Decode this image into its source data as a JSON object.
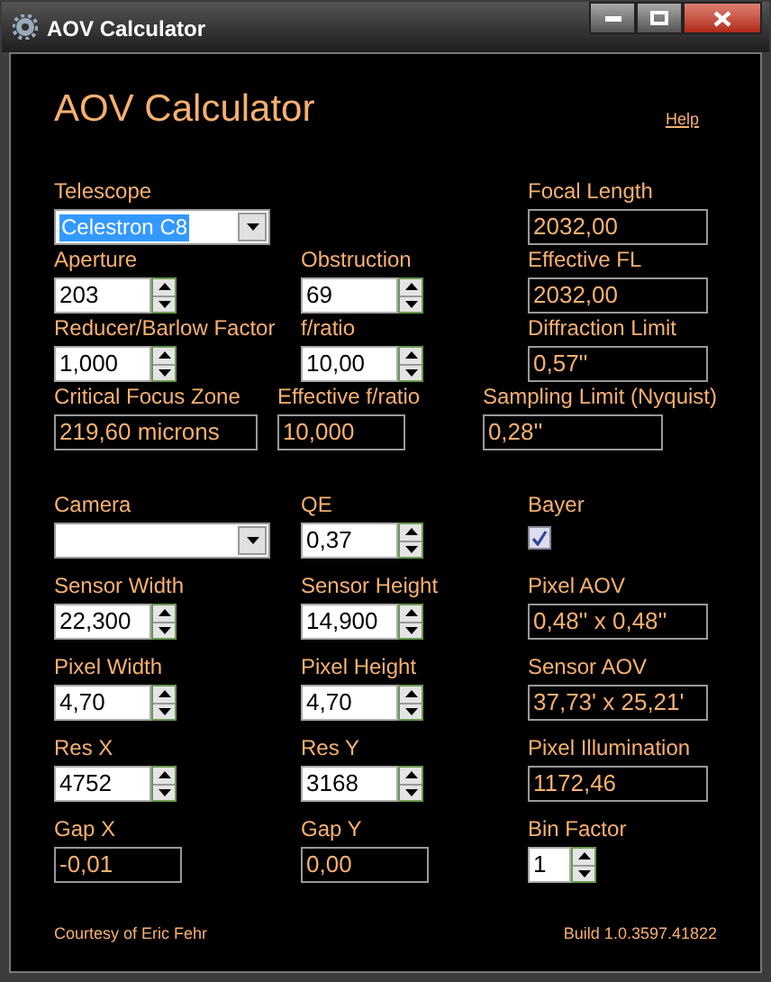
{
  "window": {
    "title": "AOV Calculator"
  },
  "heading": "AOV Calculator",
  "help_link": "Help",
  "sections": [
    {
      "rows": [
        {
          "left": {
            "label": "Telescope",
            "kind": "dropdown",
            "value": "Celestron C8",
            "text_selected": true
          },
          "right": {
            "label": "Focal Length",
            "kind": "readout",
            "value": "2032,00"
          }
        },
        {
          "left": {
            "label": "Aperture",
            "kind": "spin",
            "value": "203"
          },
          "middle": {
            "label": "Obstruction",
            "kind": "spin",
            "value": "69"
          },
          "right": {
            "label": "Effective FL",
            "kind": "readout",
            "value": "2032,00"
          }
        },
        {
          "left": {
            "label": "Reducer/Barlow Factor",
            "kind": "spin",
            "value": "1,000"
          },
          "middle": {
            "label": "f/ratio",
            "kind": "spin",
            "value": "10,00"
          },
          "right": {
            "label": "Diffraction Limit",
            "kind": "readout",
            "value": "0,57''"
          }
        },
        {
          "left": {
            "label": "Critical Focus Zone",
            "kind": "readout",
            "value": "219,60 microns"
          },
          "middle": {
            "label": "Effective f/ratio",
            "kind": "readout",
            "value": "10,000"
          },
          "right": {
            "label": "Sampling Limit (Nyquist)",
            "kind": "readout",
            "value": "0,28''"
          }
        }
      ]
    },
    {
      "rows": [
        {
          "left": {
            "label": "Camera",
            "kind": "dropdown"
          },
          "middle": {
            "label": "QE",
            "kind": "spin",
            "value": "0,37"
          },
          "right": {
            "label": "Bayer",
            "kind": "checkbox",
            "checked": true
          }
        },
        {
          "left": {
            "label": "Sensor Width",
            "kind": "spin",
            "value": "22,300"
          },
          "middle": {
            "label": "Sensor Height",
            "kind": "spin",
            "value": "14,900"
          },
          "right": {
            "label": "Pixel AOV",
            "kind": "readout",
            "value": "0,48'' x 0,48''"
          }
        },
        {
          "left": {
            "label": "Pixel Width",
            "kind": "spin",
            "value": "4,70"
          },
          "middle": {
            "label": "Pixel Height",
            "kind": "spin",
            "value": "4,70"
          },
          "right": {
            "label": "Sensor AOV",
            "kind": "readout",
            "value": "37,73' x 25,21'"
          }
        },
        {
          "left": {
            "label": "Res X",
            "kind": "spin",
            "value": "4752"
          },
          "middle": {
            "label": "Res Y",
            "kind": "spin",
            "value": "3168"
          },
          "right": {
            "label": "Pixel Illumination",
            "kind": "readout",
            "value": "1172,46"
          }
        },
        {
          "left": {
            "label": "Gap X",
            "kind": "readout",
            "value": "-0,01"
          },
          "middle": {
            "label": "Gap Y",
            "kind": "readout",
            "value": "0,00"
          },
          "right": {
            "label": "Bin Factor",
            "kind": "spin_small",
            "value": "1"
          }
        }
      ]
    }
  ],
  "footer": {
    "credit": "Courtesy of Eric Fehr",
    "build": "Build 1.0.3597.41822"
  }
}
